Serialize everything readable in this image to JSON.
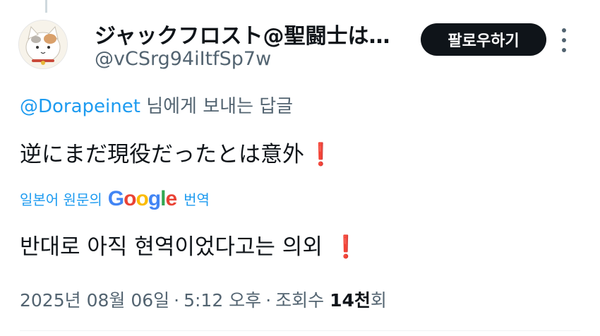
{
  "user": {
    "display_name": "ジャックフロスト@聖闘士は…",
    "handle": "@vCSrg94iItfSp7w"
  },
  "actions": {
    "follow_label": "팔로우하기",
    "more_icon": "more-dots-icon"
  },
  "reply": {
    "mention": "@Dorapeinet",
    "suffix": " 님에게 보내는 답글"
  },
  "tweet": {
    "text": "逆にまだ現役だったとは意外",
    "emoji": "❗"
  },
  "translation": {
    "prefix": "일본어 원문의",
    "google_letters": [
      "G",
      "o",
      "o",
      "g",
      "l",
      "e"
    ],
    "google_colors": [
      "#4285F4",
      "#EA4335",
      "#FBBC05",
      "#4285F4",
      "#34A853",
      "#EA4335"
    ],
    "action": "번역",
    "text": "반대로 아직 현역이었다고는 의외",
    "emoji": "❗"
  },
  "meta": {
    "date": "2025년 08월 06일",
    "time": "5:12 오후",
    "views_label": "조회수",
    "views_count": "14천",
    "views_unit": "회",
    "separator": "·"
  },
  "colors": {
    "text": "#0f1419",
    "secondary": "#536471",
    "link": "#1d9bf0",
    "button_bg": "#0f1419",
    "exclamation": "#e0245e"
  }
}
